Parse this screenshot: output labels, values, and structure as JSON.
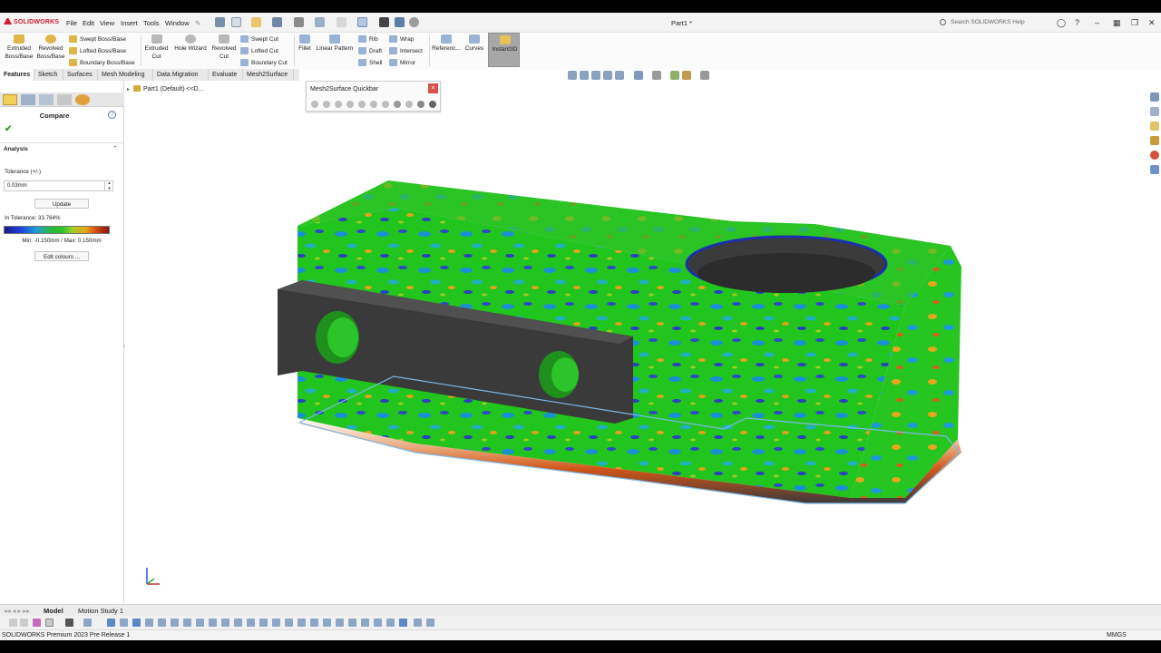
{
  "app": {
    "brand": "SOLIDWORKS",
    "document_title": "Part1 *",
    "status": "SOLIDWORKS Premium 2023 Pre Release 1",
    "units": "MMGS"
  },
  "menu": [
    "File",
    "Edit",
    "View",
    "Insert",
    "Tools",
    "Window"
  ],
  "search": {
    "placeholder": "Search SOLIDWORKS Help"
  },
  "ribbon": {
    "extruded_boss": "Extruded Boss/Base",
    "revolved_boss": "Revolved Boss/Base",
    "swept_boss": "Swept Boss/Base",
    "lofted_boss": "Lofted Boss/Base",
    "boundary_boss": "Boundary Boss/Base",
    "extruded_cut": "Extruded Cut",
    "hole_wizard": "Hole Wizard",
    "revolved_cut": "Revolved Cut",
    "swept_cut": "Swept Cut",
    "lofted_cut": "Lofted Cut",
    "boundary_cut": "Boundary Cut",
    "fillet": "Fillet",
    "linear_pattern": "Linear Pattern",
    "rib": "Rib",
    "draft": "Draft",
    "shell": "Shell",
    "wrap": "Wrap",
    "intersect": "Intersect",
    "mirror": "Mirror",
    "reference": "Referenc...",
    "curves": "Curves",
    "instant3d": "Instant3D"
  },
  "tabs": [
    "Features",
    "Sketch",
    "Surfaces",
    "Mesh Modeling",
    "Data Migration",
    "Evaluate",
    "Mesh2Surface"
  ],
  "feature_tree": {
    "root": "Part1 (Default) <<D..."
  },
  "property_manager": {
    "title": "Compare",
    "section": "Analysis",
    "tolerance_label": "Tolerance (+/-)",
    "tolerance_value": "0.03mm",
    "update_button": "Update",
    "in_tolerance": "In Tolerance: 33.764%",
    "min_max": "Min: -0.150mm / Max: 0.150mm",
    "edit_colours_button": "Edit colours ..."
  },
  "colors": {
    "accent": "#d01f2e",
    "mesh_green": "#1fbf1a",
    "model_dark": "#3c3c3c"
  },
  "quickbar": {
    "title": "Mesh2Surface Quickbar"
  },
  "bottom_tabs": [
    "Model",
    "Motion Study 1"
  ]
}
